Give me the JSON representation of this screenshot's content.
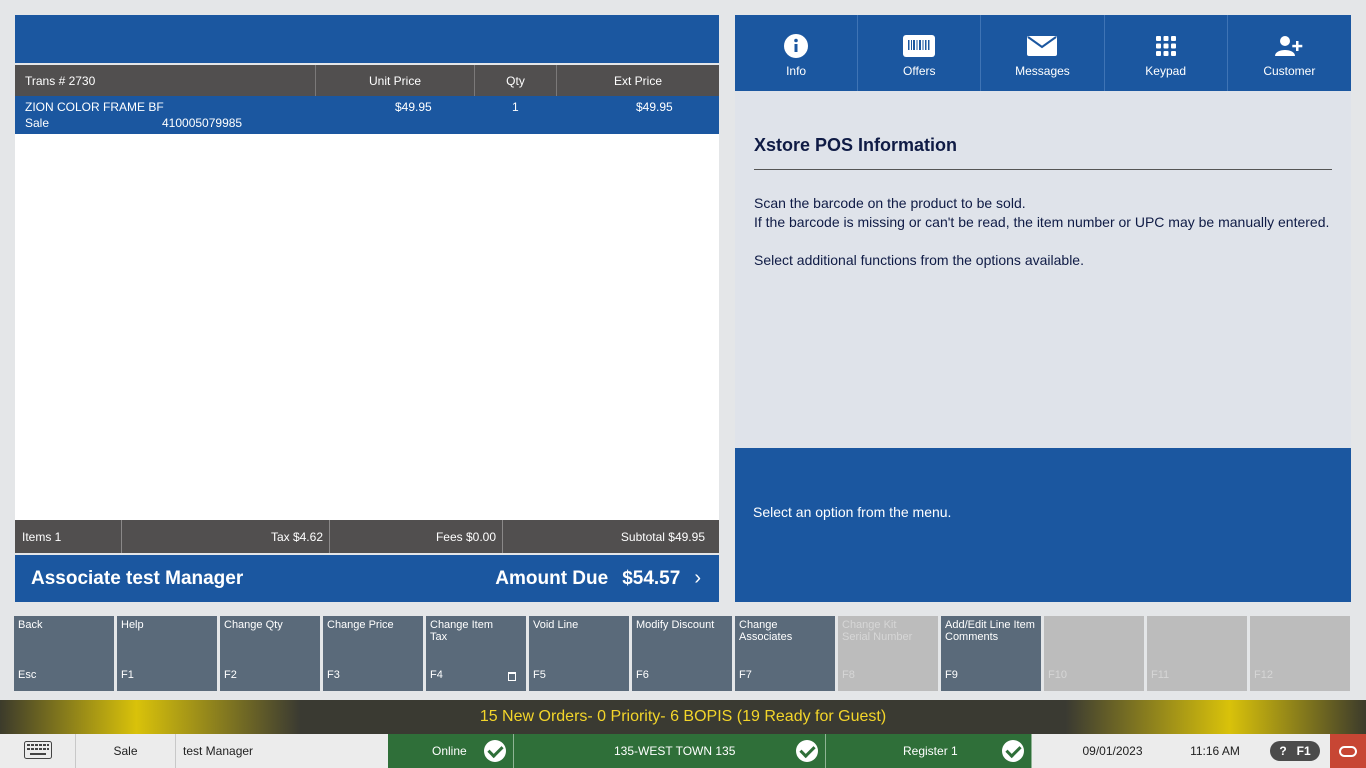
{
  "grid": {
    "header_trans": "Trans #  2730",
    "header_unit_price": "Unit Price",
    "header_qty": "Qty",
    "header_ext_price": "Ext Price",
    "lines": [
      {
        "description": "ZION COLOR FRAME BF",
        "type": "Sale",
        "sku": "410005079985",
        "unit_price": "$49.95",
        "qty": "1",
        "ext_price": "$49.95"
      }
    ]
  },
  "totals": {
    "items": "Items 1",
    "tax": "Tax $4.62",
    "fees": "Fees $0.00",
    "subtotal": "Subtotal $49.95"
  },
  "associate": "Associate test Manager",
  "amount_due_label": "Amount Due",
  "amount_due_value": "$54.57",
  "tabs": [
    {
      "label": "Info",
      "icon": "info-icon",
      "active": true
    },
    {
      "label": "Offers",
      "icon": "barcode-icon",
      "active": false
    },
    {
      "label": "Messages",
      "icon": "envelope-icon",
      "active": false
    },
    {
      "label": "Keypad",
      "icon": "keypad-icon",
      "active": false
    },
    {
      "label": "Customer",
      "icon": "add-customer-icon",
      "active": false
    }
  ],
  "info": {
    "title": "Xstore POS Information",
    "line1": "Scan the barcode on the product to be sold.",
    "line2": "If the barcode is missing or can't be read, the item number or UPC may be manually entered.",
    "line3": "Select additional functions from the options available."
  },
  "prompt": "Select an option from the menu.",
  "fkeys": [
    {
      "label": "Back",
      "key": "Esc",
      "enabled": true
    },
    {
      "label": "Help",
      "key": "F1",
      "enabled": true
    },
    {
      "label": "Change Qty",
      "key": "F2",
      "enabled": true
    },
    {
      "label": "Change Price",
      "key": "F3",
      "enabled": true
    },
    {
      "label": "Change Item Tax",
      "key": "F4",
      "enabled": true
    },
    {
      "label": "Void Line",
      "key": "F5",
      "enabled": true
    },
    {
      "label": "Modify Discount",
      "key": "F6",
      "enabled": true
    },
    {
      "label": "Change Associates",
      "key": "F7",
      "enabled": true
    },
    {
      "label": "Change Kit Serial Number",
      "key": "F8",
      "enabled": false
    },
    {
      "label": "Add/Edit Line Item Comments",
      "key": "F9",
      "enabled": true
    },
    {
      "label": "",
      "key": "F10",
      "enabled": false
    },
    {
      "label": "",
      "key": "F11",
      "enabled": false
    },
    {
      "label": "",
      "key": "F12",
      "enabled": false
    }
  ],
  "banner": "15 New Orders- 0 Priority- 6 BOPIS (19 Ready for Guest)",
  "status": {
    "mode": "Sale",
    "user": "test Manager",
    "online": "Online",
    "store": "135-WEST TOWN 135",
    "register": "Register 1",
    "date": "09/01/2023",
    "time": "11:16 AM",
    "help_q": "?",
    "help_key": "F1"
  },
  "colors": {
    "brand_blue": "#1b57a0",
    "grid_dark": "#514f4f",
    "fkey": "#5a6a7a",
    "status_green": "#2f6f39",
    "banner_text": "#f3d52a",
    "oracle_red": "#c74634"
  }
}
